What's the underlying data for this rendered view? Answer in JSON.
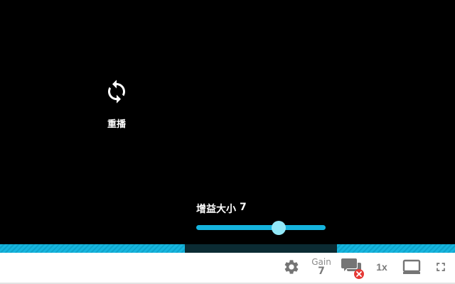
{
  "replay": {
    "label": "重播",
    "icon": "replay-icon"
  },
  "gain_panel": {
    "title": "增益大小",
    "value": "7",
    "slider_fraction": 0.64
  },
  "progress": {
    "buffered_segments": [
      {
        "start": 0.0,
        "end": 0.406
      },
      {
        "start": 0.741,
        "end": 1.0
      }
    ],
    "color_buffered": "#16b6df",
    "color_background": "#0b2b33"
  },
  "controls": {
    "settings_icon": "gear-icon",
    "gain_label": "Gain",
    "gain_value": "7",
    "danmaku_icon": "comments-disabled-icon",
    "speed_label": "1x",
    "screen_icon": "theater-mode-icon",
    "fullscreen_icon": "fullscreen-icon"
  },
  "colors": {
    "accent": "#15b3dd",
    "thumb": "#92e8f8",
    "icon_gray": "#757575",
    "error_red": "#e53935"
  }
}
